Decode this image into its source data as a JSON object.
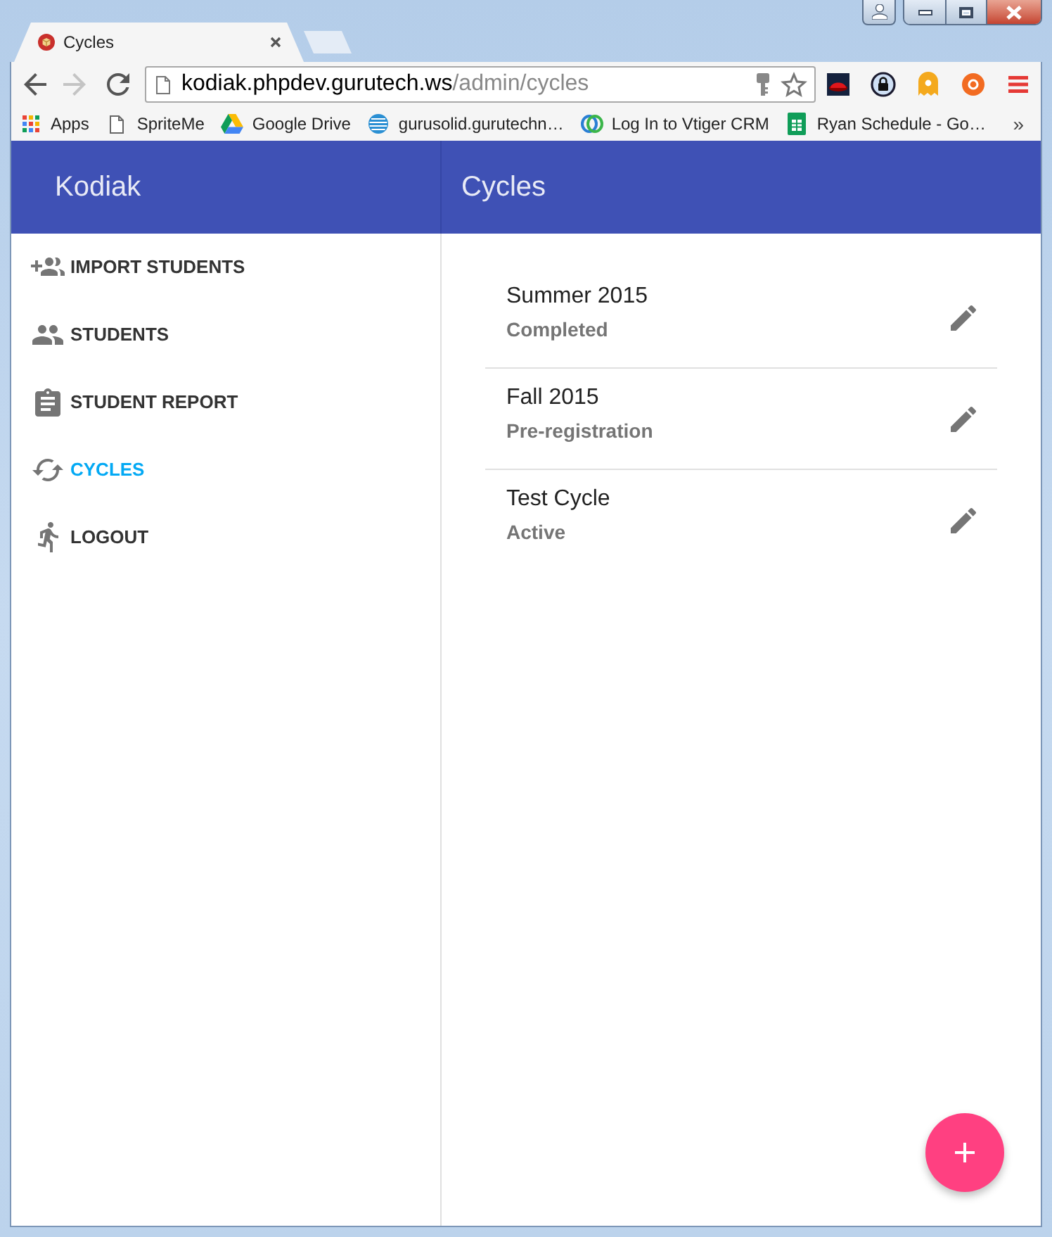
{
  "browser": {
    "tab": {
      "title": "Cycles"
    },
    "navigation": {
      "back": {
        "disabled": false
      },
      "forward": {
        "disabled": true
      }
    },
    "address_bar": {
      "host": "kodiak.phpdev.gurutech.ws",
      "path": "/admin/cycles"
    },
    "bookmarks": [
      {
        "label": "Apps"
      },
      {
        "label": "SpriteMe"
      },
      {
        "label": "Google Drive"
      },
      {
        "label": "gurusolid.gurutechn…"
      },
      {
        "label": "Log In to Vtiger CRM"
      },
      {
        "label": "Ryan Schedule - Go…"
      }
    ],
    "bookmarks_overflow": "»"
  },
  "sidebar": {
    "title": "Kodiak",
    "items": [
      {
        "label": "IMPORT STUDENTS",
        "selected": false
      },
      {
        "label": "STUDENTS",
        "selected": false
      },
      {
        "label": "STUDENT REPORT",
        "selected": false
      },
      {
        "label": "CYCLES",
        "selected": true
      },
      {
        "label": "LOGOUT",
        "selected": false
      }
    ]
  },
  "main": {
    "title": "Cycles",
    "cycles": [
      {
        "name": "Summer 2015",
        "status": "Completed"
      },
      {
        "name": "Fall 2015",
        "status": "Pre-registration"
      },
      {
        "name": "Test Cycle",
        "status": "Active"
      }
    ]
  }
}
